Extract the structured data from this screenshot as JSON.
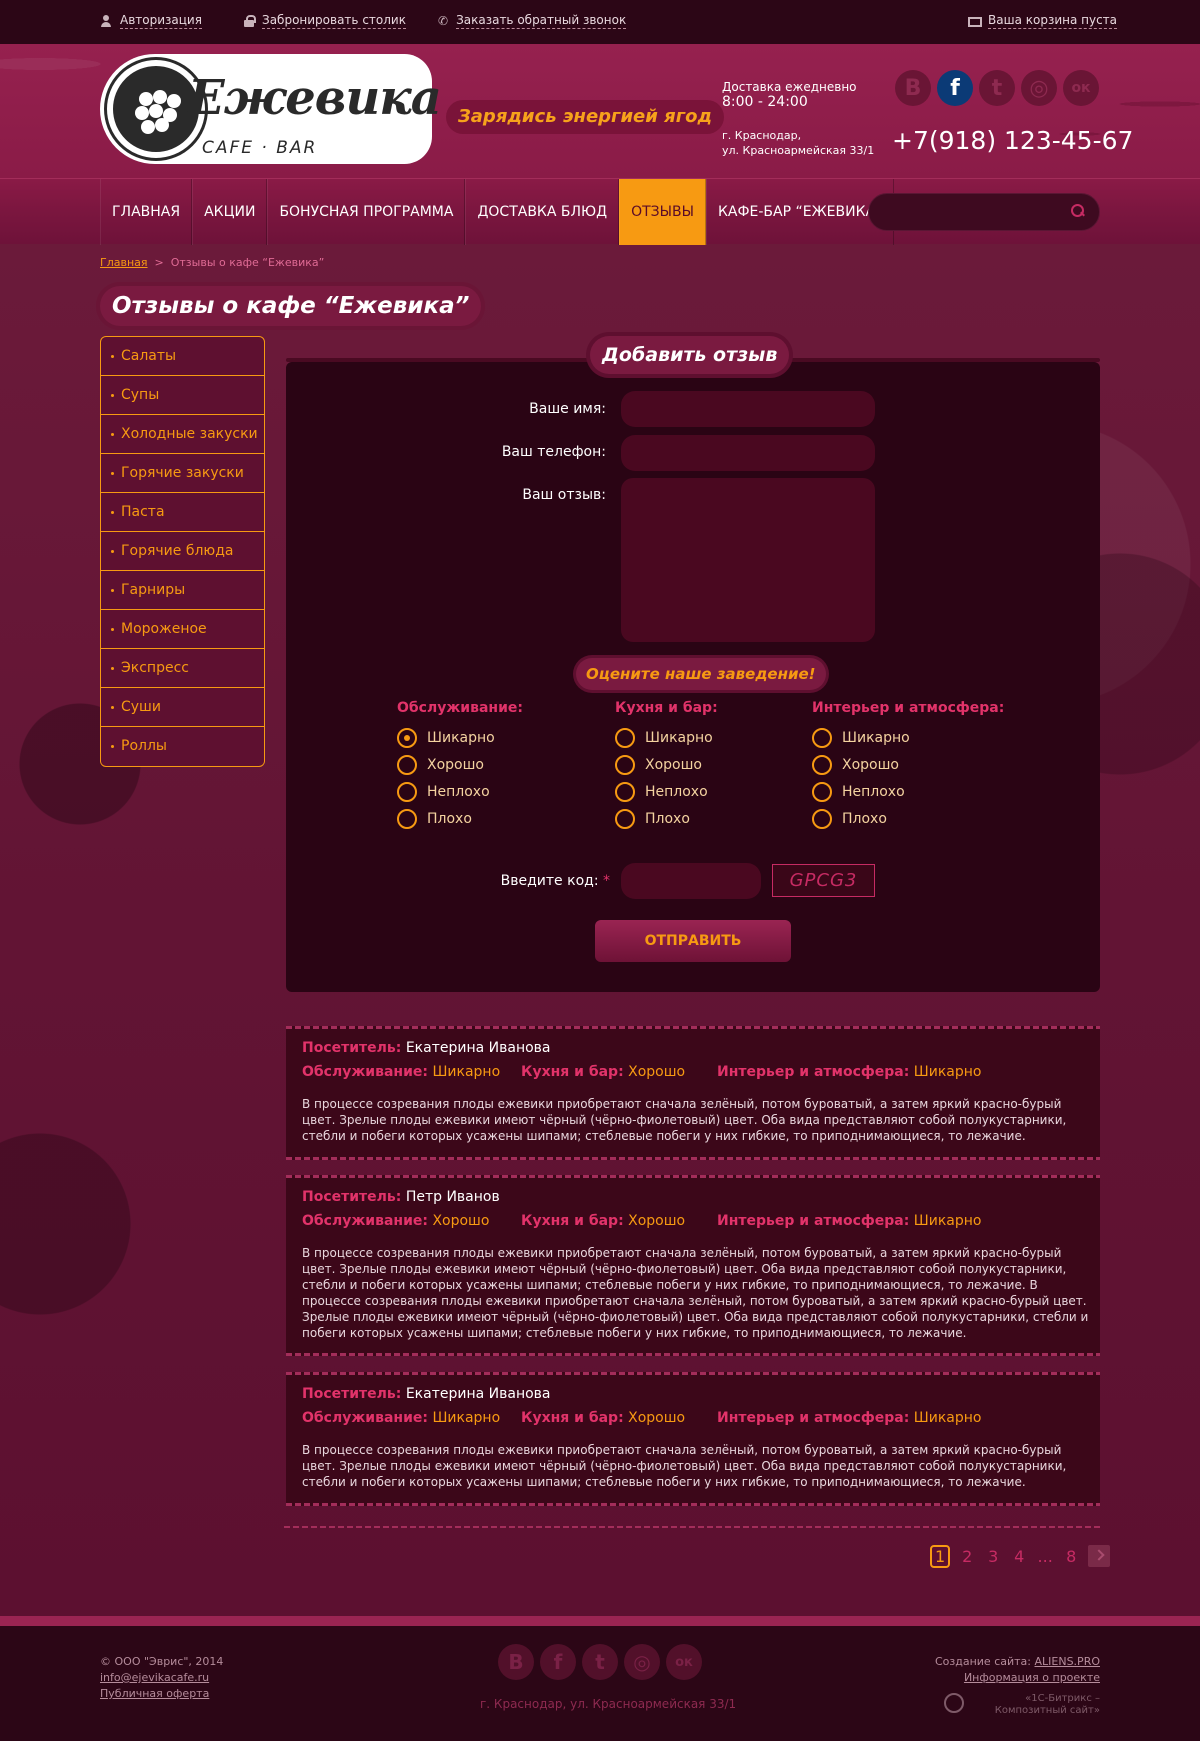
{
  "topbar": {
    "auth": "Авторизация",
    "reserve": "Забронировать столик",
    "callback": "Заказать обратный звонок",
    "cart": "Ваша корзина пуста"
  },
  "header": {
    "logo_title": "Ежевика",
    "logo_sub": "CAFE · BAR",
    "slogan": "Зарядись энергией ягод",
    "delivery_label": "Доставка ежедневно",
    "delivery_hours": "8:00 - 24:00",
    "address_line1": "г. Краснодар,",
    "address_line2": "ул. Красноармейская 33/1",
    "phone": "+7(918) 123-45-67",
    "social": [
      "В",
      "f",
      "t",
      "◎",
      "ок"
    ]
  },
  "nav": {
    "items": [
      "Главная",
      "Акции",
      "Бонусная программа",
      "Доставка блюд",
      "Отзывы",
      "Кафе-бар “Ежевика”"
    ],
    "active_index": 4
  },
  "breadcrumb": {
    "home": "Главная",
    "sep": ">",
    "current": "Отзывы о кафе “Ежевика”"
  },
  "page_title": "Отзывы о кафе “Ежевика”",
  "sidebar": {
    "items": [
      "Салаты",
      "Супы",
      "Холодные закуски",
      "Горячие закуски",
      "Паста",
      "Горячие блюда",
      "Гарниры",
      "Мороженое",
      "Экспресс",
      "Суши",
      "Роллы"
    ]
  },
  "form": {
    "title": "Добавить отзыв",
    "name_label": "Ваше имя:",
    "phone_label": "Ваш телефон:",
    "review_label": "Ваш отзыв:",
    "rate_title": "Оцените наше заведение!",
    "groups": [
      {
        "title": "Обслуживание:",
        "options": [
          "Шикарно",
          "Хорошо",
          "Неплохо",
          "Плохо"
        ],
        "selected": 0
      },
      {
        "title": "Кухня и бар:",
        "options": [
          "Шикарно",
          "Хорошо",
          "Неплохо",
          "Плохо"
        ],
        "selected": -1
      },
      {
        "title": "Интерьер и атмосфера:",
        "options": [
          "Шикарно",
          "Хорошо",
          "Неплохо",
          "Плохо"
        ],
        "selected": -1
      }
    ],
    "captcha_label": "Введите код:",
    "captcha_req": "*",
    "captcha_text": "GPCG3",
    "submit": "Отправить"
  },
  "reviews": [
    {
      "visitor_label": "Посетитель:",
      "visitor": "Екатерина Иванова",
      "service_label": "Обслуживание:",
      "service": "Шикарно",
      "kitchen_label": "Кухня и бар:",
      "kitchen": "Хорошо",
      "interior_label": "Интерьер и атмосфера:",
      "interior": "Шикарно",
      "text": "В процессе созревания плоды ежевики приобретают сначала зелёный, потом буроватый, а затем яркий красно-бурый цвет. Зрелые плоды ежевики имеют чёрный (чёрно-фиолетовый) цвет. Оба вида представляют собой полукустарники, стебли и побеги которых усажены шипами; стеблевые побеги у них гибкие, то приподнимающиеся, то лежачие."
    },
    {
      "visitor_label": "Посетитель:",
      "visitor": "Петр Иванов",
      "service_label": "Обслуживание:",
      "service": "Хорошо",
      "kitchen_label": "Кухня и бар:",
      "kitchen": "Хорошо",
      "interior_label": "Интерьер и атмосфера:",
      "interior": "Шикарно",
      "text": "В процессе созревания плоды ежевики приобретают сначала зелёный, потом буроватый, а затем яркий красно-бурый цвет. Зрелые плоды ежевики имеют чёрный (чёрно-фиолетовый) цвет. Оба вида представляют собой полукустарники, стебли и побеги которых усажены шипами; стеблевые побеги у них гибкие, то приподнимающиеся, то лежачие. В процессе созревания плоды ежевики приобретают сначала зелёный, потом буроватый, а затем яркий красно-бурый цвет. Зрелые плоды ежевики имеют чёрный (чёрно-фиолетовый) цвет. Оба вида представляют собой полукустарники, стебли и побеги которых усажены шипами; стеблевые побеги у них гибкие, то приподнимающиеся, то лежачие."
    },
    {
      "visitor_label": "Посетитель:",
      "visitor": "Екатерина Иванова",
      "service_label": "Обслуживание:",
      "service": "Шикарно",
      "kitchen_label": "Кухня и бар:",
      "kitchen": "Хорошо",
      "interior_label": "Интерьер и атмосфера:",
      "interior": "Шикарно",
      "text": "В процессе созревания плоды ежевики приобретают сначала зелёный, потом буроватый, а затем яркий красно-бурый цвет. Зрелые плоды ежевики имеют чёрный (чёрно-фиолетовый) цвет. Оба вида представляют собой полукустарники, стебли и побеги которых усажены шипами; стеблевые побеги у них гибкие, то приподнимающиеся, то лежачие."
    }
  ],
  "pagination": {
    "pages": [
      "1",
      "2",
      "3",
      "4",
      "...",
      "8"
    ],
    "current": "1"
  },
  "footer": {
    "copyright": "© ООО \"Эврис\", 2014",
    "email": "info@ejevikacafe.ru",
    "offer": "Публичная оферта",
    "address": "г. Краснодар, ул. Красноармейская 33/1",
    "made_by_label": "Создание сайта:",
    "made_by": "ALIENS.PRO",
    "about": "Информация о проекте",
    "bitrix_line1": "«1С-Битрикс –",
    "bitrix_line2": "Композитный сайт»",
    "social": [
      "В",
      "f",
      "t",
      "◎",
      "ок"
    ]
  }
}
